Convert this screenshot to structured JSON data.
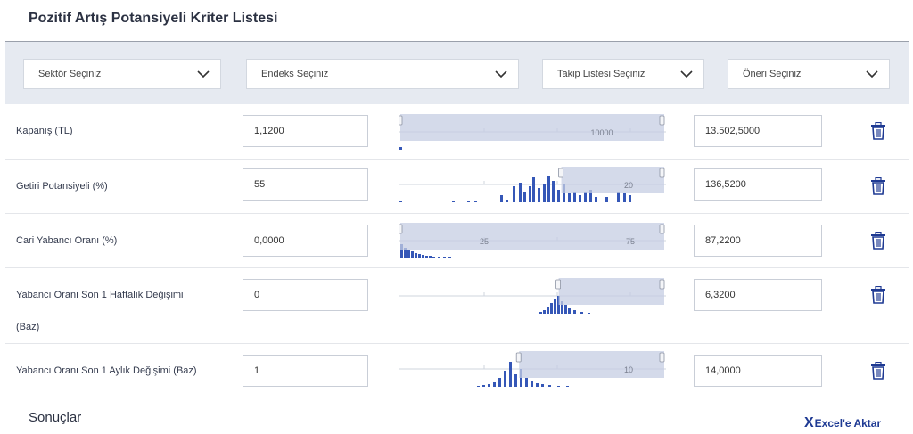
{
  "page": {
    "title": "Pozitif Artış Potansiyeli Kriter Listesi"
  },
  "filters": [
    {
      "label": "Sektör Seçiniz"
    },
    {
      "label": "Endeks Seçiniz"
    },
    {
      "label": "Takip Listesi Seçiniz"
    },
    {
      "label": "Öneri Seçiniz"
    }
  ],
  "criteria": [
    {
      "label": "Kapanış (TL)",
      "min": "1,1200",
      "max": "13.502,5000",
      "ticks": [
        "10000"
      ],
      "range": [
        0.0,
        1.0
      ]
    },
    {
      "label": "Getiri Potansiyeli (%)",
      "min": "55",
      "max": "136,5200",
      "ticks": [
        "20"
      ],
      "range": [
        0.61,
        1.0
      ]
    },
    {
      "label": "Cari Yabancı Oranı (%)",
      "min": "0,0000",
      "max": "87,2200",
      "ticks": [
        "25",
        "75"
      ],
      "range": [
        0.0,
        1.0
      ]
    },
    {
      "label": "Yabancı Oranı Son 1 Haftalık Değişimi",
      "label_line2": "(Baz)",
      "min": "0",
      "max": "6,3200",
      "ticks": [],
      "range": [
        0.6,
        1.0
      ]
    },
    {
      "label": "Yabancı Oranı Son 1 Aylık Değişimi (Baz)",
      "min": "1",
      "max": "14,0000",
      "ticks": [
        "10"
      ],
      "range": [
        0.45,
        1.0
      ]
    }
  ],
  "results": {
    "title": "Sonuçlar",
    "export_label": "Excel'e Aktar",
    "export_icon": "excel-x-icon"
  },
  "colors": {
    "accent": "#1f3a93",
    "slider_fill": "#c5cee3",
    "histogram": "#3557b7",
    "filter_bg": "#e6eaf1"
  }
}
